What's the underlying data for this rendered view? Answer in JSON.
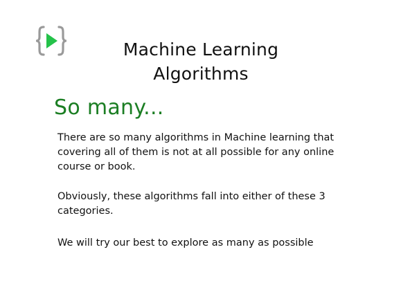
{
  "slide": {
    "logo_icon": "code-brackets-play-icon",
    "colors": {
      "logo_bracket": "#9a9a9a",
      "logo_play": "#24c24a",
      "subtitle": "#1b7e23",
      "text": "#111111"
    },
    "title_line1": "Machine Learning",
    "title_line2": "Algorithms",
    "subtitle": "So many...",
    "paragraphs": {
      "p1": {
        "line1": "There are so many algorithms in Machine learning that",
        "line2": "covering all of them is not at all possible for any online",
        "line3": "course or book."
      },
      "p2": {
        "line1": "Obviously, these algorithms fall into either of these 3",
        "line2": "categories."
      },
      "p3": {
        "line1": "We will try our best to explore as many as possible"
      }
    }
  }
}
